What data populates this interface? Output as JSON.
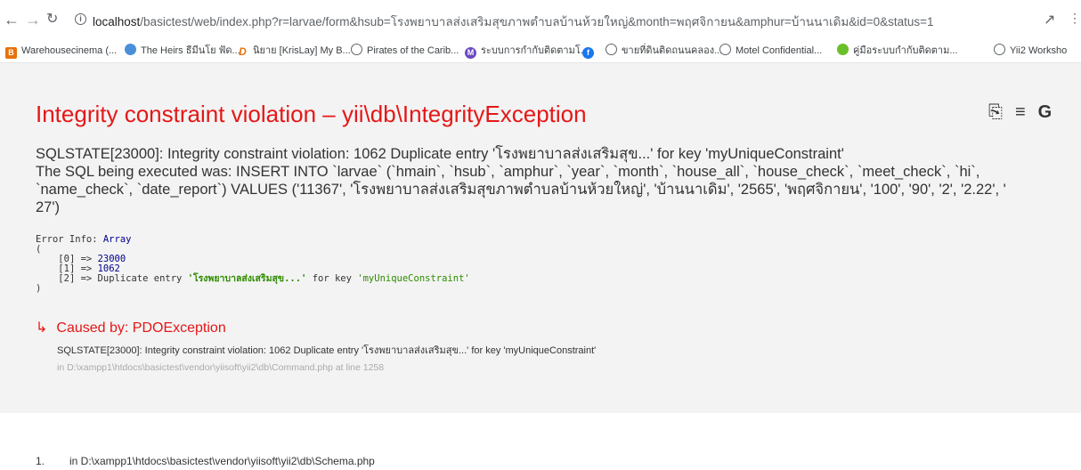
{
  "browser": {
    "nav": {
      "back": "←",
      "forward": "→",
      "reload": "C"
    },
    "url_host": "localhost",
    "url_rest": "/basictest/web/index.php?r=larvae/form&hsub=โรงพยาบาลส่งเสริมสุขภาพตำบลบ้านห้วยใหญ่&month=พฤศจิกายน&amphur=บ้านนาเดิม&id=0&status=1"
  },
  "bookmarks": [
    {
      "label": "Warehousecinema (...",
      "icon": "warehouse-icon",
      "color": "#e8710a"
    },
    {
      "label": "The Heirs ธีมีนโย ฟัด...",
      "icon": "heirs-icon",
      "color": "#4a90d9"
    },
    {
      "label": "นิยาย [KrisLay] My B...",
      "icon": "dek-d-icon",
      "color": "#e8710a"
    },
    {
      "label": "Pirates of the Carib...",
      "icon": "globe-icon",
      "color": "#5f6368"
    },
    {
      "label": "ระบบการกำกับติดตามโ...",
      "icon": "m-icon",
      "color": "#6a4ac2"
    },
    {
      "label": "",
      "icon": "facebook-icon",
      "color": "#1877f2"
    },
    {
      "label": "ขายที่ดินติดถนนคลอง...",
      "icon": "globe-icon",
      "color": "#5f6368"
    },
    {
      "label": "Motel Confidential...",
      "icon": "globe-icon",
      "color": "#5f6368"
    },
    {
      "label": "คู่มือระบบกำกับติดตาม...",
      "icon": "leaf-icon",
      "color": "#6bbf2a"
    },
    {
      "label": "Yii2 Worksho",
      "icon": "globe-icon",
      "color": "#5f6368"
    }
  ],
  "error": {
    "title": "Integrity constraint violation",
    "dash": "–",
    "exception": "yii\\db\\IntegrityException",
    "message_line1": "SQLSTATE[23000]: Integrity constraint violation: 1062 Duplicate entry 'โรงพยาบาลส่งเสริมสุข...' for key 'myUniqueConstraint'",
    "message_line2": "The SQL being executed was: INSERT INTO `larvae` (`hmain`, `hsub`, `amphur`, `year`, `month`, `house_all`, `house_check`, `meet_check`, `hi`,",
    "message_line3": "`name_check`, `date_report`) VALUES ('11367', 'โรงพยาบาลส่งเสริมสุขภาพตำบลบ้านห้วยใหญ่', 'บ้านนาเดิม', '2565', 'พฤศจิกายน', '100', '90', '2', '2.22', '",
    "message_line4": "27')",
    "info_label": "Error Info: ",
    "info_type": "Array",
    "info_open": "(",
    "info_close": ")",
    "info_rows": [
      {
        "key": "[0] => ",
        "value": "23000"
      },
      {
        "key": "[1] => ",
        "value": "1062"
      },
      {
        "key": "[2] => Duplicate entry ",
        "value": "'โรงพยาบาลส่งเสริมสุข...'",
        "tail": " for key ",
        "tail_value": "'myUniqueConstraint'"
      }
    ],
    "caused_arrow": "↳",
    "caused_label": "Caused by: PDOException",
    "caused_message": "SQLSTATE[23000]: Integrity constraint violation: 1062 Duplicate entry 'โรงพยาบาลส่งเสริมสุข...' for key 'myUniqueConstraint'",
    "caused_file": "in D:\\xampp1\\htdocs\\basictest\\vendor\\yiisoft\\yii2\\db\\Command.php at line 1258"
  },
  "stack": {
    "number": "1.",
    "path": "in D:\\xampp1\\htdocs\\basictest\\vendor\\yiisoft\\yii2\\db\\Schema.php"
  }
}
